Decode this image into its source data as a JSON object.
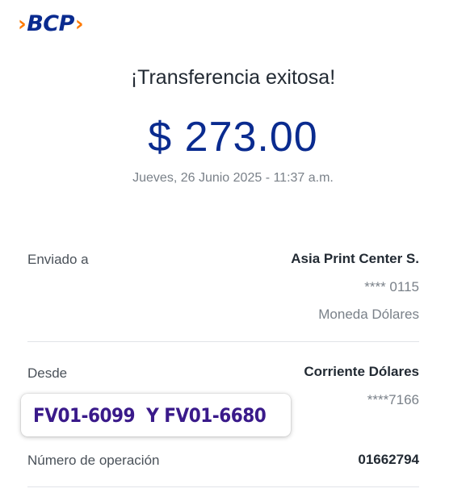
{
  "brand": {
    "logo_text": "BCP",
    "chevron_left": "›",
    "chevron_right": "›"
  },
  "receipt": {
    "title": "¡Transferencia exitosa!",
    "amount": "$ 273.00",
    "datetime": "Jueves, 26 Junio 2025 - 11:37 a.m."
  },
  "sent_to": {
    "label": "Enviado a",
    "name": "Asia Print Center S.",
    "account": "**** 0115",
    "currency": "Moneda Dólares"
  },
  "from": {
    "label": "Desde",
    "account_type": "Corriente Dólares",
    "account": "****7166"
  },
  "operation": {
    "label": "Número de operación",
    "number": "01662794"
  },
  "overlay_note": {
    "text": "FV01-6099  Y FV01-6680"
  },
  "colors": {
    "brand_blue": "#0a2b8f",
    "brand_orange": "#ff7a00",
    "note_purple": "#3a1a8a"
  }
}
